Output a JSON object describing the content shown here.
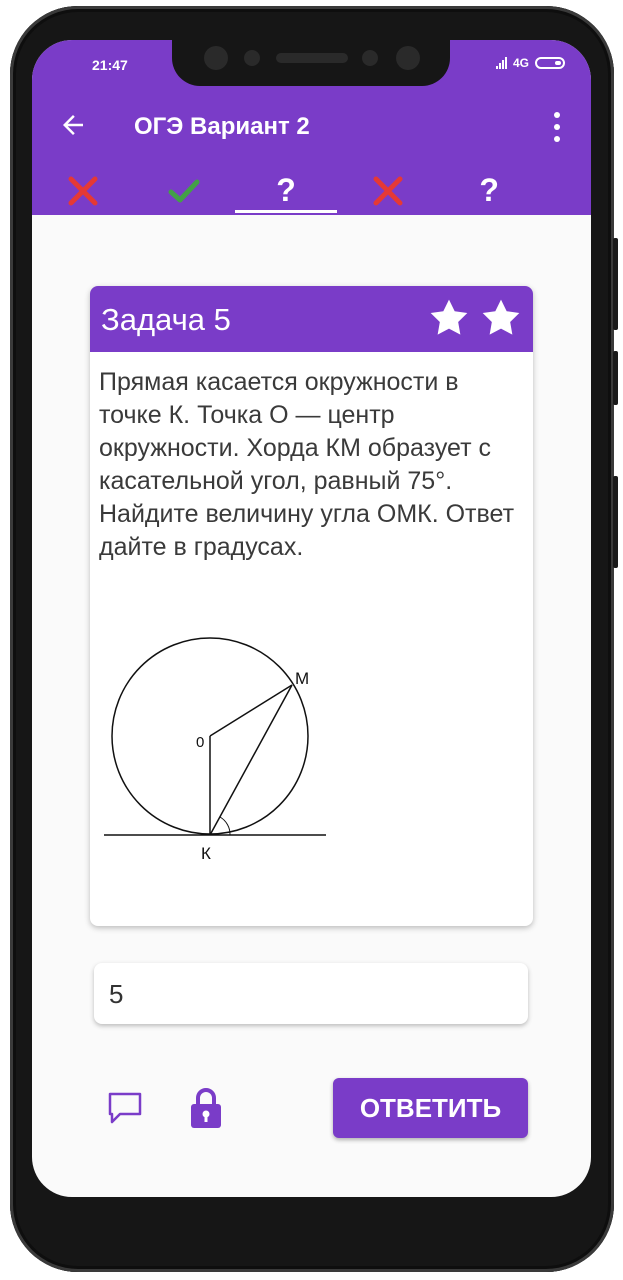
{
  "status_bar": {
    "time": "21:47",
    "network": "4G"
  },
  "toolbar": {
    "title": "ОГЭ Вариант 2"
  },
  "tabs": [
    {
      "icon": "cross-icon",
      "state": "wrong"
    },
    {
      "icon": "check-icon",
      "state": "correct"
    },
    {
      "icon": "question-icon",
      "label": "?",
      "state": "unanswered",
      "active": true
    },
    {
      "icon": "cross-icon",
      "state": "wrong"
    },
    {
      "icon": "question-icon",
      "label": "?",
      "state": "unanswered"
    }
  ],
  "task": {
    "title": "Задача 5",
    "stars": [
      "star-icon",
      "star-icon"
    ],
    "text": "Прямая касается окружности в точке К. Точка О — центр окружности. Хорда КМ образует с касательной угол, равный 75°. Найдите величину угла ОМК. Ответ дайте в градусах.",
    "diagram": {
      "label_o": "0",
      "label_m": "M",
      "label_k": "К"
    }
  },
  "answer_field": {
    "value": "5"
  },
  "actions": {
    "submit_label": "ОТВЕТИТЬ"
  },
  "colors": {
    "primary": "#7a3cc8",
    "wrong": "#e53935",
    "correct": "#43a047"
  }
}
